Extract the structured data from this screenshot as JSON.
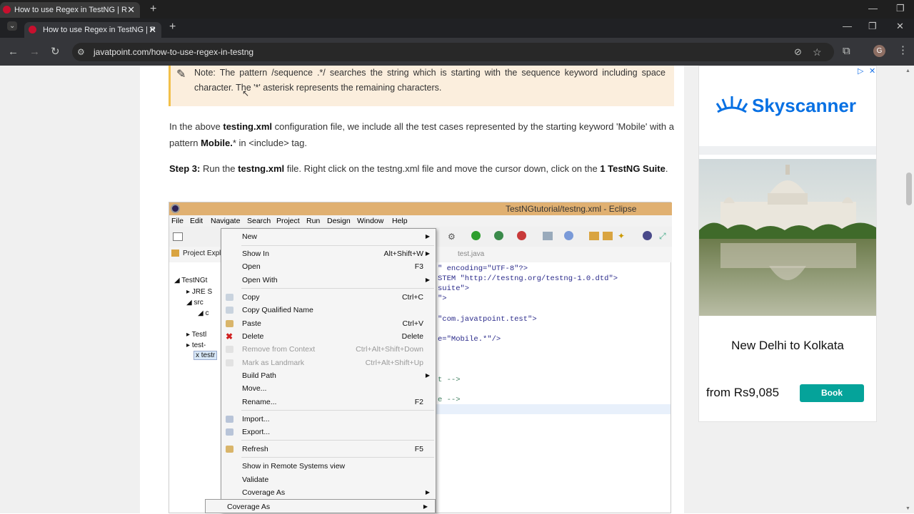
{
  "browser": {
    "outer_tab_title": "How to use Regex in TestNG | R",
    "tab_title": "How to use Regex in TestNG | R",
    "url": "javatpoint.com/how-to-use-regex-in-testng",
    "profile_initial": "G"
  },
  "note": {
    "text": "Note: The pattern /sequence .*/ searches the string which is starting with the sequence keyword including space character. The '*' asterisk represents the remaining characters."
  },
  "para1": {
    "t1": "In the above ",
    "b1": "testing.xml",
    "t2": " configuration file, we include all the test cases represented by the starting keyword 'Mobile' with a pattern ",
    "b2": "Mobile.",
    "t3": "* in <include> tag."
  },
  "para2": {
    "b1": "Step 3:",
    "t1": " Run the ",
    "b2": "testng.xml",
    "t2": " file. Right click on the testng.xml file and move the cursor down, click on the ",
    "b3": "1 TestNG Suite",
    "t3": "."
  },
  "eclipse": {
    "title": "TestNGtutorial/testng.xml - Eclipse",
    "menus": [
      "File",
      "Edit",
      "Navigate",
      "Search",
      "Project",
      "Run",
      "Design",
      "Window",
      "Help"
    ],
    "explorer_label": "Project Explo",
    "editor_tab": "test.java",
    "tree": [
      "TestNGt",
      "JRE S",
      "src",
      "c",
      "Testl",
      "test-",
      "testr"
    ],
    "code": [
      "\" encoding=\"UTF-8\"?>",
      "STEM \"http://testng.org/testng-1.0.dtd\">",
      "suite\">",
      "\">",
      "\"com.javatpoint.test\">",
      "e=\"Mobile.*\"/>",
      "t -->",
      "e -->"
    ]
  },
  "context_menu": {
    "items": [
      {
        "label": "New",
        "shortcut": "",
        "submenu": true,
        "disabled": false
      },
      {
        "label": "Show In",
        "shortcut": "Alt+Shift+W",
        "submenu": true,
        "disabled": false
      },
      {
        "label": "Open",
        "shortcut": "F3",
        "submenu": false,
        "disabled": false
      },
      {
        "label": "Open With",
        "shortcut": "",
        "submenu": true,
        "disabled": false
      },
      {
        "label": "Copy",
        "shortcut": "Ctrl+C",
        "submenu": false,
        "disabled": false
      },
      {
        "label": "Copy Qualified Name",
        "shortcut": "",
        "submenu": false,
        "disabled": false
      },
      {
        "label": "Paste",
        "shortcut": "Ctrl+V",
        "submenu": false,
        "disabled": false
      },
      {
        "label": "Delete",
        "shortcut": "Delete",
        "submenu": false,
        "disabled": false
      },
      {
        "label": "Remove from Context",
        "shortcut": "Ctrl+Alt+Shift+Down",
        "submenu": false,
        "disabled": true
      },
      {
        "label": "Mark as Landmark",
        "shortcut": "Ctrl+Alt+Shift+Up",
        "submenu": false,
        "disabled": true
      },
      {
        "label": "Build Path",
        "shortcut": "",
        "submenu": true,
        "disabled": false
      },
      {
        "label": "Move...",
        "shortcut": "",
        "submenu": false,
        "disabled": false
      },
      {
        "label": "Rename...",
        "shortcut": "F2",
        "submenu": false,
        "disabled": false
      },
      {
        "label": "Import...",
        "shortcut": "",
        "submenu": false,
        "disabled": false
      },
      {
        "label": "Export...",
        "shortcut": "",
        "submenu": false,
        "disabled": false
      },
      {
        "label": "Refresh",
        "shortcut": "F5",
        "submenu": false,
        "disabled": false
      },
      {
        "label": "Show in Remote Systems view",
        "shortcut": "",
        "submenu": false,
        "disabled": false
      },
      {
        "label": "Validate",
        "shortcut": "",
        "submenu": false,
        "disabled": false
      },
      {
        "label": "Coverage As",
        "shortcut": "",
        "submenu": true,
        "disabled": false
      }
    ],
    "duplicate_item": "Coverage As"
  },
  "ad": {
    "brand": "Skyscanner",
    "route": "New Delhi to Kolkata",
    "price": "from Rs9,085",
    "cta": "Book"
  },
  "colors": {
    "accent": "#05a39a",
    "brand": "#0770e3",
    "note_bg": "#fbeedd",
    "note_border": "#f2c04a"
  }
}
